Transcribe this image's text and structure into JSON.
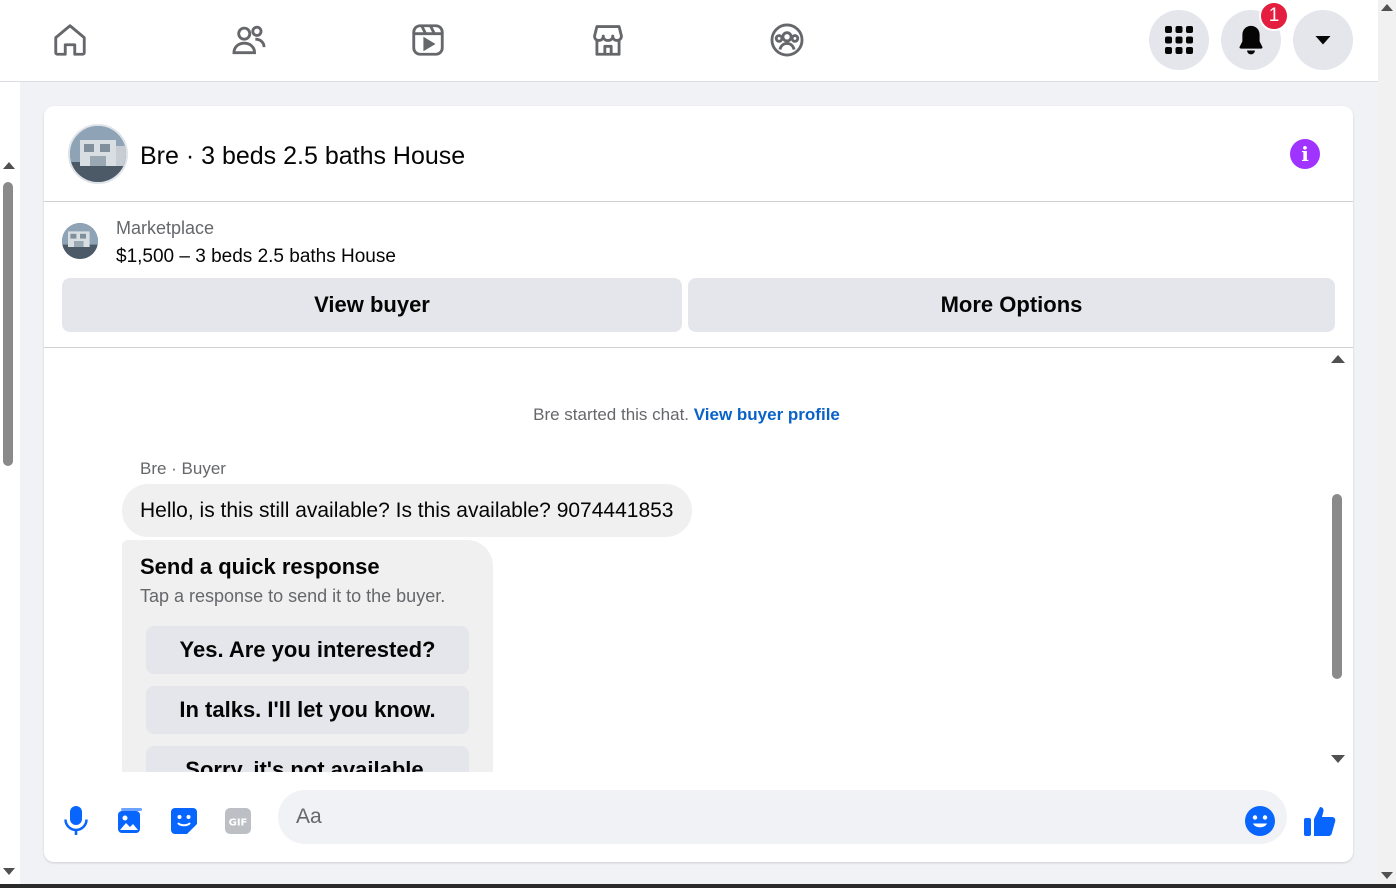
{
  "nav": {
    "icons": [
      "home-icon",
      "friends-icon",
      "video-icon",
      "marketplace-icon",
      "groups-icon"
    ],
    "right": [
      "menu-grid-icon",
      "bell-icon",
      "account-chevron-icon"
    ],
    "notification_count": "1"
  },
  "header": {
    "title": "Bre · 3 beds 2.5 baths House"
  },
  "listing": {
    "source": "Marketplace",
    "title": "$1,500 – 3 beds 2.5 baths House",
    "view_buyer_label": "View buyer",
    "more_options_label": "More Options"
  },
  "chat": {
    "started_text": "Bre started this chat.",
    "view_profile_link": "View buyer profile",
    "sender": "Bre · Buyer",
    "message": "Hello, is this still available? Is this available? 9074441853",
    "quick_title": "Send a quick response",
    "quick_sub": "Tap a response to send it to the buyer.",
    "quick_options": [
      "Yes. Are you interested?",
      "In talks. I'll let you know.",
      "Sorry, it's not available."
    ]
  },
  "composer": {
    "placeholder": "Aa"
  },
  "colors": {
    "accent": "#0866ff",
    "info": "#a033ff",
    "badge": "#e41e3f"
  }
}
